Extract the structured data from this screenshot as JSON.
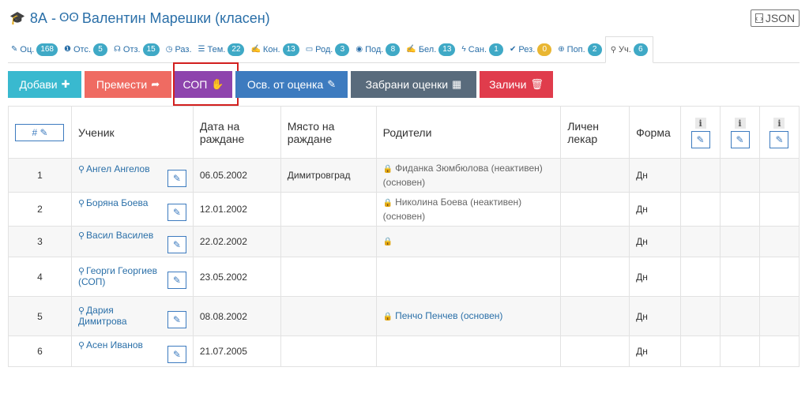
{
  "header": {
    "title": "8А - ",
    "teacher": "Валентин Марешки (класен)",
    "cap_icon": "graduation-cap-icon",
    "glasses_icon": "glasses-icon"
  },
  "json_button": {
    "label": "JSON",
    "icon": "code-file-icon"
  },
  "tabs": [
    {
      "label": "Оц.",
      "count": "168",
      "icon": "pencil-icon"
    },
    {
      "label": "Отс.",
      "count": "5",
      "icon": "info-circle-icon"
    },
    {
      "label": "Отз.",
      "count": "15",
      "icon": "feedback-icon"
    },
    {
      "label": "Раз.",
      "count": "",
      "icon": "clock-icon"
    },
    {
      "label": "Тем.",
      "count": "22",
      "icon": "list-icon"
    },
    {
      "label": "Кон.",
      "count": "13",
      "icon": "edit-icon"
    },
    {
      "label": "Род.",
      "count": "3",
      "icon": "calendar-icon"
    },
    {
      "label": "Под.",
      "count": "8",
      "icon": "eye-icon"
    },
    {
      "label": "Бел.",
      "count": "13",
      "icon": "edit-icon"
    },
    {
      "label": "Сан.",
      "count": "1",
      "icon": "bolt-icon"
    },
    {
      "label": "Рез.",
      "count": "0",
      "icon": "check-circle-icon"
    },
    {
      "label": "Поп.",
      "count": "2",
      "icon": "lifebuoy-icon"
    },
    {
      "label": "Уч.",
      "count": "6",
      "icon": "person-icon"
    }
  ],
  "toolbar": {
    "add": "Добави",
    "move": "Премести",
    "sop": "СОП",
    "osv": "Осв. от оценка",
    "forbid": "Забрани оценки",
    "delete": "Заличи"
  },
  "table": {
    "headers": {
      "num": "#",
      "student": "Ученик",
      "birth": "Дата на раждане",
      "place": "Място на раждане",
      "parents": "Родители",
      "doctor": "Личен лекар",
      "form": "Форма",
      "info": "i"
    },
    "rows": [
      {
        "num": "1",
        "name": "Ангел Ангелов",
        "birth": "06.05.2002",
        "place": "Димитровград",
        "parent": "Фиданка Зюмбюлова (неактивен) (основен)",
        "parent_link": false,
        "doctor": "",
        "form": "Дн"
      },
      {
        "num": "2",
        "name": "Боряна Боева",
        "birth": "12.01.2002",
        "place": "",
        "parent": "Николина Боева (неактивен) (основен)",
        "parent_link": false,
        "doctor": "",
        "form": "Дн"
      },
      {
        "num": "3",
        "name": "Васил Василев",
        "birth": "22.02.2002",
        "place": "",
        "parent": "",
        "parent_link": true,
        "doctor": "",
        "form": "Дн"
      },
      {
        "num": "4",
        "name": "Георги Георгиев (СОП)",
        "birth": "23.05.2002",
        "place": "",
        "parent": null,
        "parent_link": false,
        "doctor": "",
        "form": "Дн"
      },
      {
        "num": "5",
        "name": "Дария Димитрова",
        "birth": "08.08.2002",
        "place": "",
        "parent": "Пенчо Пенчев (основен)",
        "parent_link": true,
        "doctor": "",
        "form": "Дн"
      },
      {
        "num": "6",
        "name": "Асен Иванов",
        "birth": "21.07.2005",
        "place": "",
        "parent": null,
        "parent_link": false,
        "doctor": "",
        "form": "Дн"
      }
    ]
  }
}
